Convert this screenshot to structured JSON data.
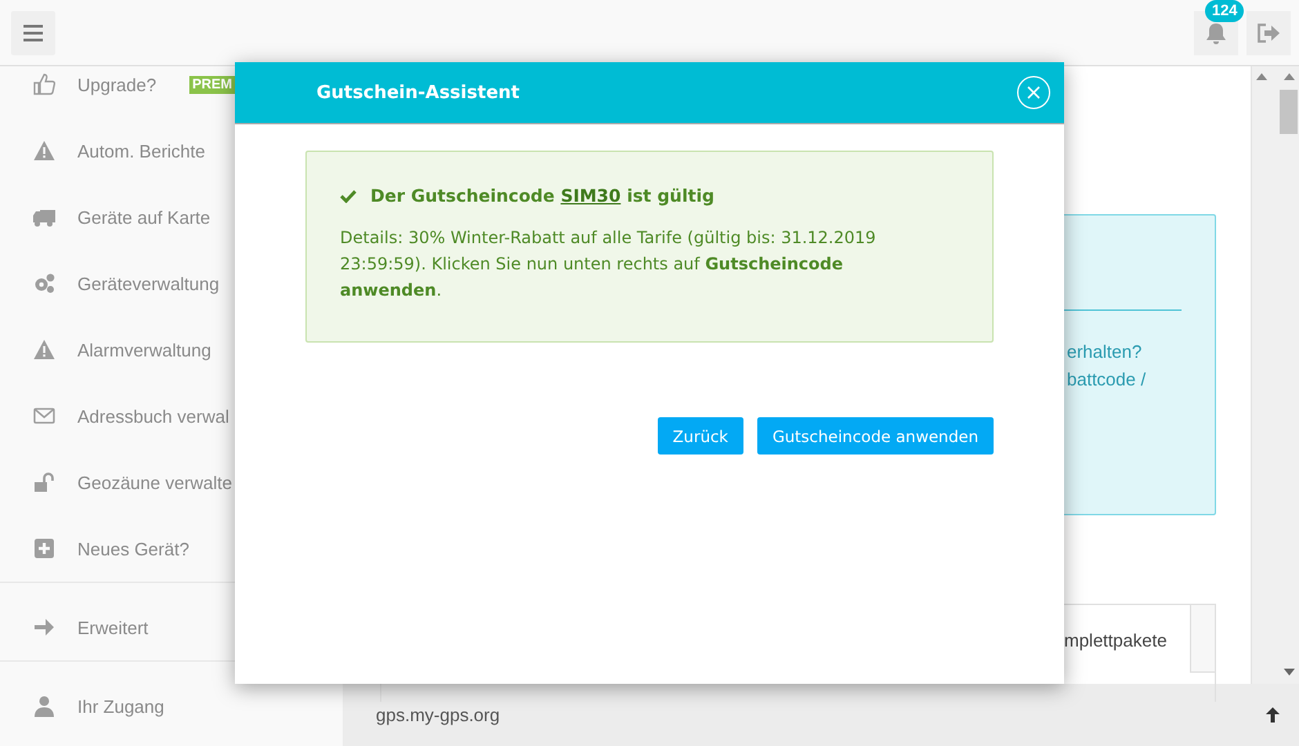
{
  "topbar": {
    "notification_count": "124"
  },
  "sidebar": {
    "sections": [
      {
        "items": [
          {
            "label": "Upgrade?",
            "badge": "PREM"
          },
          {
            "label": "Autom. Berichte"
          },
          {
            "label": "Geräte auf Karte"
          },
          {
            "label": "Geräteverwaltung"
          },
          {
            "label": "Alarmverwaltung"
          },
          {
            "label": "Adressbuch verwal"
          },
          {
            "label": "Geozäune verwalte"
          },
          {
            "label": "Neues Gerät?"
          }
        ]
      },
      {
        "items": [
          {
            "label": "Erweitert"
          }
        ]
      },
      {
        "items": [
          {
            "label": "Ihr Zugang"
          }
        ]
      }
    ]
  },
  "main": {
    "info_panel": {
      "lines": [
        "erhalten?",
        "battcode /"
      ]
    },
    "tab_label": "mplettpakete"
  },
  "footer": {
    "domain": "gps.my-gps.org"
  },
  "dialog": {
    "title": "Gutschein-Assistent",
    "alert": {
      "heading_before": "Der Gutscheincode",
      "code": "SIM30",
      "heading_after": "ist gültig",
      "details": "Details: 30% Winter-Rabatt auf alle Tarife (gültig bis: 31.12.2019 23:59:59). Klicken Sie nun unten rechts auf **Gutscheincode anwenden**."
    },
    "buttons": [
      "Zurück",
      "Gutscheincode anwenden"
    ]
  }
}
